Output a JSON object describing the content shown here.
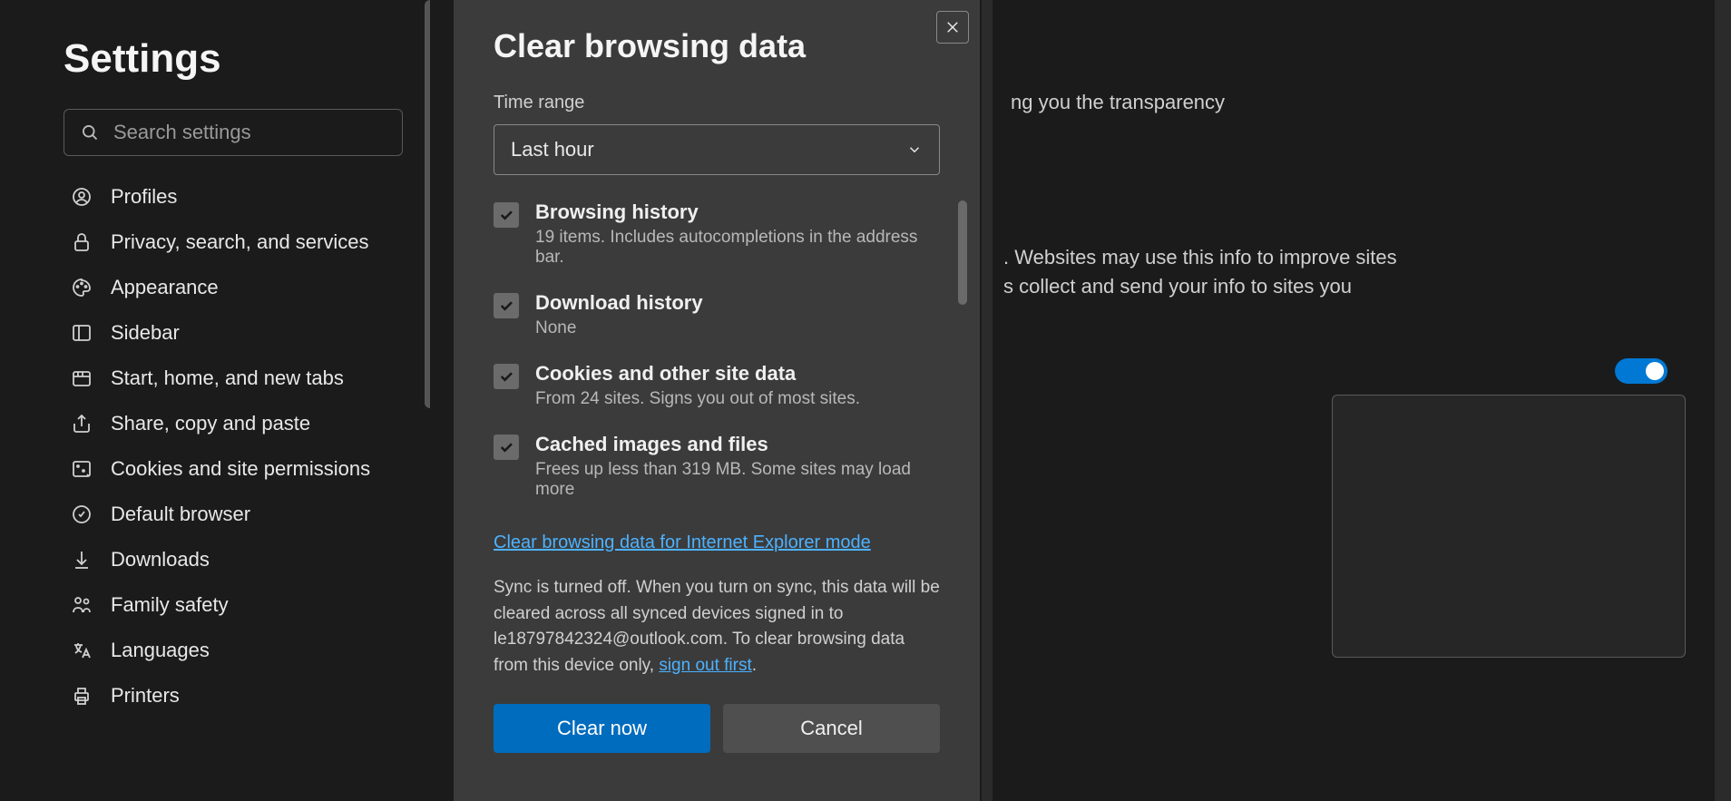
{
  "page": {
    "title": "Settings",
    "search_placeholder": "Search settings"
  },
  "sidebar": {
    "items": [
      {
        "label": "Profiles",
        "icon": "profile"
      },
      {
        "label": "Privacy, search, and services",
        "icon": "lock"
      },
      {
        "label": "Appearance",
        "icon": "palette"
      },
      {
        "label": "Sidebar",
        "icon": "sidebar"
      },
      {
        "label": "Start, home, and new tabs",
        "icon": "tabs"
      },
      {
        "label": "Share, copy and paste",
        "icon": "share"
      },
      {
        "label": "Cookies and site permissions",
        "icon": "cookies"
      },
      {
        "label": "Default browser",
        "icon": "default"
      },
      {
        "label": "Downloads",
        "icon": "download"
      },
      {
        "label": "Family safety",
        "icon": "family"
      },
      {
        "label": "Languages",
        "icon": "language"
      },
      {
        "label": "Printers",
        "icon": "printer"
      }
    ]
  },
  "background": {
    "line1": "ng you the transparency",
    "line2a": ". Websites may use this info to improve sites",
    "line2b": "s collect and send your info to sites you",
    "toggle_on": true
  },
  "modal": {
    "title": "Clear browsing data",
    "time_range_label": "Time range",
    "time_range_value": "Last hour",
    "checkboxes": [
      {
        "title": "Browsing history",
        "desc": "19 items. Includes autocompletions in the address bar.",
        "checked": true
      },
      {
        "title": "Download history",
        "desc": "None",
        "checked": true
      },
      {
        "title": "Cookies and other site data",
        "desc": "From 24 sites. Signs you out of most sites.",
        "checked": true
      },
      {
        "title": "Cached images and files",
        "desc": "Frees up less than 319 MB. Some sites may load more",
        "checked": true
      }
    ],
    "ie_link": "Clear browsing data for Internet Explorer mode",
    "sync_text_1": "Sync is turned off. When you turn on sync, this data will be cleared across all synced devices signed in to le18797842324@outlook.com. To clear browsing data from this device only, ",
    "sync_link": "sign out first",
    "sync_text_2": ".",
    "clear_btn": "Clear now",
    "cancel_btn": "Cancel"
  }
}
